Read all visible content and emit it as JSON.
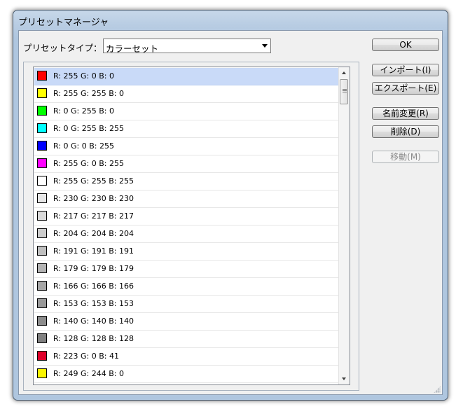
{
  "window": {
    "title": "プリセットマネージャ"
  },
  "preset_type": {
    "label": "プリセットタイプ：",
    "selected": "カラーセット"
  },
  "buttons": {
    "ok": "OK",
    "import": "インポート(I)",
    "export": "エクスポート(E)",
    "rename": "名前変更(R)",
    "delete": "削除(D)",
    "move": "移動(M)"
  },
  "colors": [
    {
      "label": "R: 255 G: 0 B: 0",
      "hex": "#ff0000",
      "selected": true
    },
    {
      "label": "R: 255 G: 255 B: 0",
      "hex": "#ffff00"
    },
    {
      "label": "R: 0 G: 255 B: 0",
      "hex": "#00ff00"
    },
    {
      "label": "R: 0 G: 255 B: 255",
      "hex": "#00ffff"
    },
    {
      "label": "R: 0 G: 0 B: 255",
      "hex": "#0000ff"
    },
    {
      "label": "R: 255 G: 0 B: 255",
      "hex": "#ff00ff"
    },
    {
      "label": "R: 255 G: 255 B: 255",
      "hex": "#ffffff"
    },
    {
      "label": "R: 230 G: 230 B: 230",
      "hex": "#e6e6e6"
    },
    {
      "label": "R: 217 G: 217 B: 217",
      "hex": "#d9d9d9"
    },
    {
      "label": "R: 204 G: 204 B: 204",
      "hex": "#cccccc"
    },
    {
      "label": "R: 191 G: 191 B: 191",
      "hex": "#bfbfbf"
    },
    {
      "label": "R: 179 G: 179 B: 179",
      "hex": "#b3b3b3"
    },
    {
      "label": "R: 166 G: 166 B: 166",
      "hex": "#a6a6a6"
    },
    {
      "label": "R: 153 G: 153 B: 153",
      "hex": "#999999"
    },
    {
      "label": "R: 140 G: 140 B: 140",
      "hex": "#8c8c8c"
    },
    {
      "label": "R: 128 G: 128 B: 128",
      "hex": "#808080"
    },
    {
      "label": "R: 223 G: 0 B: 41",
      "hex": "#df0029"
    },
    {
      "label": "R: 249 G: 244 B: 0",
      "hex": "#f9f400"
    }
  ],
  "theme": {
    "selection": "#c9daf8",
    "titlebar": "#b9cde3"
  }
}
